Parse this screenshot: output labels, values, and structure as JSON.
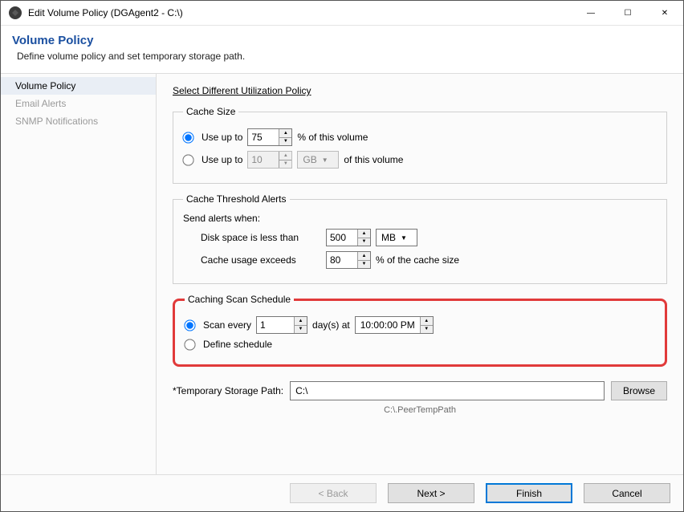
{
  "window": {
    "title": "Edit Volume Policy (DGAgent2 - C:\\)",
    "minimize_glyph": "—",
    "maximize_glyph": "☐",
    "close_glyph": "✕"
  },
  "header": {
    "title": "Volume Policy",
    "subtitle": "Define volume policy and set temporary storage path."
  },
  "sidebar": {
    "items": [
      {
        "label": "Volume Policy",
        "active": true
      },
      {
        "label": "Email Alerts",
        "active": false
      },
      {
        "label": "SNMP Notifications",
        "active": false
      }
    ]
  },
  "content": {
    "policy_link": "Select Different Utilization Policy",
    "cache_size": {
      "legend": "Cache Size",
      "opt_pct_label": "Use up to",
      "pct_value": "75",
      "pct_suffix": "% of this volume",
      "opt_abs_label": "Use up to",
      "abs_value": "10",
      "abs_unit": "GB",
      "abs_suffix": "of this volume"
    },
    "threshold": {
      "legend": "Cache Threshold Alerts",
      "intro": "Send alerts when:",
      "disk_label": "Disk space is less than",
      "disk_value": "500",
      "disk_unit": "MB",
      "usage_label": "Cache usage exceeds",
      "usage_value": "80",
      "usage_suffix": "% of the cache size"
    },
    "schedule": {
      "legend": "Caching Scan Schedule",
      "opt_every_label": "Scan every",
      "every_value": "1",
      "every_unit": "day(s) at",
      "every_time": "10:00:00 PM",
      "opt_define_label": "Define schedule"
    },
    "storage": {
      "label": "*Temporary Storage Path:",
      "value": "C:\\",
      "browse": "Browse",
      "hint": "C:\\.PeerTempPath"
    }
  },
  "footer": {
    "back": "< Back",
    "next": "Next >",
    "finish": "Finish",
    "cancel": "Cancel"
  }
}
